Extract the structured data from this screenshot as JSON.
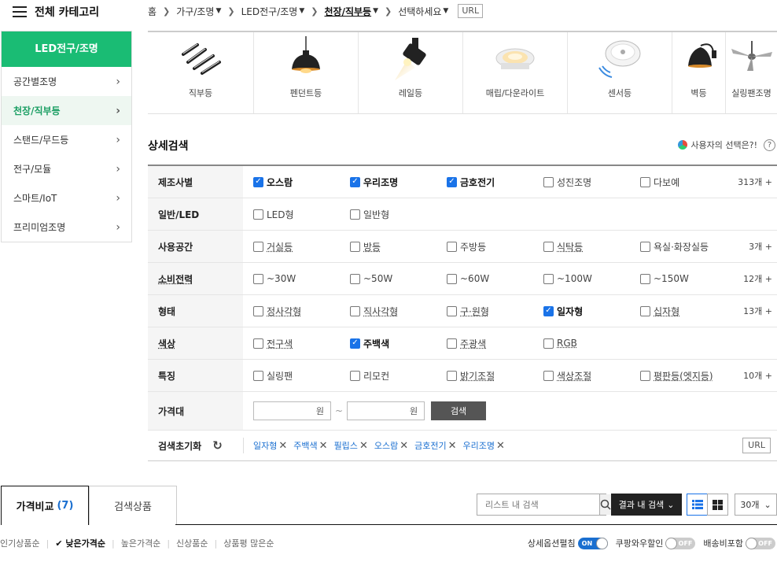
{
  "header": {
    "all_categories": "전체 카테고리"
  },
  "breadcrumb": {
    "items": [
      "홈",
      "가구/조명",
      "LED전구/조명",
      "천장/직부등",
      "선택하세요"
    ],
    "url_label": "URL"
  },
  "sidebar": {
    "title": "LED전구/조명",
    "items": [
      {
        "label": "공간별조명"
      },
      {
        "label": "천장/직부등"
      },
      {
        "label": "스탠드/무드등"
      },
      {
        "label": "전구/모듈"
      },
      {
        "label": "스마트/IoT"
      },
      {
        "label": "프리미엄조명"
      }
    ]
  },
  "categories": [
    {
      "label": "직부등",
      "icon": "ceiling-bar-light-icon"
    },
    {
      "label": "펜던트등",
      "icon": "pendant-light-icon"
    },
    {
      "label": "레일등",
      "icon": "rail-spot-light-icon"
    },
    {
      "label": "매립/다운라이트",
      "icon": "downlight-icon"
    },
    {
      "label": "센서등",
      "icon": "sensor-light-icon"
    },
    {
      "label": "벽등",
      "icon": "wall-light-icon"
    },
    {
      "label": "실링팬조명",
      "icon": "ceiling-fan-icon"
    }
  ],
  "detail": {
    "title": "상세검색",
    "user_choice": "사용자의 선택은?!",
    "help": "?"
  },
  "filters": [
    {
      "label": "제조사별",
      "options": [
        {
          "t": "오스람",
          "on": true
        },
        {
          "t": "우리조명",
          "on": true
        },
        {
          "t": "금호전기",
          "on": true
        },
        {
          "t": "성진조명",
          "on": false
        },
        {
          "t": "다보예",
          "on": false
        }
      ],
      "more": "313개 +"
    },
    {
      "label": "일반/LED",
      "options": [
        {
          "t": "LED형",
          "on": false
        },
        {
          "t": "일반형",
          "on": false
        }
      ],
      "more": ""
    },
    {
      "label": "사용공간",
      "options": [
        {
          "t": "거실등",
          "on": false
        },
        {
          "t": "방등",
          "on": false
        },
        {
          "t": "주방등",
          "on": false
        },
        {
          "t": "식탁등",
          "on": false
        },
        {
          "t": "욕실·화장실등",
          "on": false
        }
      ],
      "more": "3개 +"
    },
    {
      "label": "소비전력",
      "options": [
        {
          "t": "~30W",
          "on": false
        },
        {
          "t": "~50W",
          "on": false
        },
        {
          "t": "~60W",
          "on": false
        },
        {
          "t": "~100W",
          "on": false
        },
        {
          "t": "~150W",
          "on": false
        }
      ],
      "more": "12개 +"
    },
    {
      "label": "형태",
      "options": [
        {
          "t": "정사각형",
          "on": false
        },
        {
          "t": "직사각형",
          "on": false
        },
        {
          "t": "구·원형",
          "on": false
        },
        {
          "t": "일자형",
          "on": true
        },
        {
          "t": "십자형",
          "on": false
        }
      ],
      "more": "13개 +"
    },
    {
      "label": "색상",
      "options": [
        {
          "t": "전구색",
          "on": false
        },
        {
          "t": "주백색",
          "on": true
        },
        {
          "t": "주광색",
          "on": false
        },
        {
          "t": "RGB",
          "on": false
        }
      ],
      "more": ""
    },
    {
      "label": "특징",
      "options": [
        {
          "t": "실링팬",
          "on": false
        },
        {
          "t": "리모컨",
          "on": false
        },
        {
          "t": "밝기조절",
          "on": false
        },
        {
          "t": "색상조절",
          "on": false
        },
        {
          "t": "평판등(엣지등)",
          "on": false
        }
      ],
      "more": "10개 +"
    }
  ],
  "price": {
    "label": "가격대",
    "unit": "원",
    "search_label": "검색"
  },
  "reset": {
    "label": "검색초기화",
    "chips": [
      "일자형",
      "주백색",
      "필립스",
      "오스람",
      "금호전기",
      "우리조명"
    ],
    "url_label": "URL"
  },
  "tabs": [
    {
      "label": "가격비교",
      "count": "(7)"
    },
    {
      "label": "검색상품",
      "count": ""
    }
  ],
  "list_search": {
    "placeholder": "리스트 내 검색",
    "result_search": "결과 내 검색",
    "per_page": "30개"
  },
  "sort": {
    "items": [
      "인기상품순",
      "낮은가격순",
      "높은가격순",
      "신상품순",
      "상품평 많은순"
    ]
  },
  "toggles": [
    {
      "label": "상세옵션펼침",
      "state": "ON"
    },
    {
      "label": "쿠팡와우할인",
      "state": "OFF"
    },
    {
      "label": "배송비포함",
      "state": "OFF"
    }
  ],
  "colors": {
    "accent": "#1abc74",
    "link": "#1a6fd0",
    "check": "#1a73e8"
  }
}
